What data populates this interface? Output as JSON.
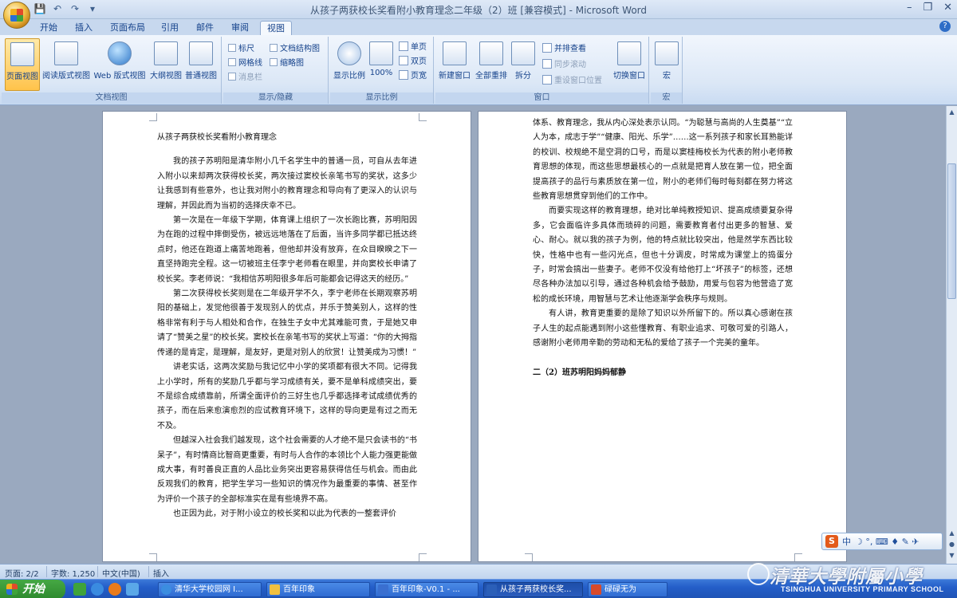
{
  "window": {
    "title": "从孩子两获校长奖看附小教育理念二年级（2）班 [兼容模式] - Microsoft Word",
    "controls": {
      "minimize": "–",
      "maximize": "❐",
      "close": "✕"
    }
  },
  "qat": {
    "save": "💾",
    "undo": "↶",
    "redo": "↷",
    "more": "▾"
  },
  "tabs": [
    {
      "label": "开始"
    },
    {
      "label": "插入"
    },
    {
      "label": "页面布局"
    },
    {
      "label": "引用"
    },
    {
      "label": "邮件"
    },
    {
      "label": "审阅"
    },
    {
      "label": "视图"
    }
  ],
  "ribbon": {
    "doc_views": {
      "label": "文档视图",
      "buttons": [
        {
          "label": "页面视图",
          "active": true
        },
        {
          "label": "阅读版式视图"
        },
        {
          "label": "Web 版式视图"
        },
        {
          "label": "大纲视图"
        },
        {
          "label": "普通视图"
        }
      ]
    },
    "show_hide": {
      "label": "显示/隐藏",
      "items": [
        {
          "label": "标尺"
        },
        {
          "label": "文档结构图"
        },
        {
          "label": "网格线"
        },
        {
          "label": "缩略图"
        },
        {
          "label": "消息栏"
        }
      ]
    },
    "zoom": {
      "label": "显示比例",
      "zoom_btn": "显示比例",
      "hundred": "100%",
      "one_page": "单页",
      "two_pages": "双页",
      "page_width": "页宽"
    },
    "window": {
      "label": "窗口",
      "new_window": "新建窗口",
      "arrange_all": "全部重排",
      "split": "拆分",
      "side_by_side": "并排查看",
      "sync_scroll": "同步滚动",
      "reset_pos": "重设窗口位置",
      "switch_windows": "切换窗口"
    },
    "macros": {
      "label": "宏",
      "btn": "宏"
    }
  },
  "doc": {
    "title": "从孩子两获校长奖看附小教育理念",
    "left_paragraphs": [
      "我的孩子苏明阳是清华附小几千名学生中的普通一员，可自从去年进入附小以来却两次获得校长奖，两次接过窦校长亲笔书写的奖状，这多少让我感到有些意外，也让我对附小的教育理念和导向有了更深入的认识与理解，并因此而为当初的选择庆幸不已。",
      "第一次是在一年级下学期，体育课上组织了一次长跑比赛，苏明阳因为在跑的过程中摔倒受伤，被远远地落在了后面，当许多同学都已抵达终点时，他还在跑道上痛苦地跑着，但他却并没有放弃，在众目睽睽之下一直坚持跑完全程。这一切被班主任李宁老师看在眼里，并向窦校长申请了校长奖。李老师说：“我相信苏明阳很多年后可能都会记得这天的经历。”",
      "第二次获得校长奖则是在二年级开学不久，李宁老师在长期观察苏明阳的基础上，发觉他很善于发现别人的优点，并乐于赞美别人，这样的性格非常有利于与人相处和合作，在独生子女中尤其难能可贵，于是她又申请了“赞美之星”的校长奖。窦校长在亲笔书写的奖状上写道：“你的大拇指传递的是肯定，是理解，是友好，更是对别人的欣赏！让赞美成为习惯！”",
      "讲老实话，这两次奖励与我记忆中小学的奖项都有很大不同。记得我上小学时，所有的奖励几乎都与学习成绩有关，要不是单科成绩突出，要不是综合成绩靠前，所谓全面评价的三好生也几乎都选择考试成绩优秀的孩子，而在后来愈演愈烈的应试教育环境下，这样的导向更是有过之而无不及。",
      "但越深入社会我们越发现，这个社会需要的人才绝不是只会读书的“书呆子”，有时情商比智商更重要，有时与人合作的本领比个人能力强更能做成大事，有时善良正直的人品比业务突出更容易获得信任与机会。而由此反观我们的教育，把学生学习一些知识的情况作为最重要的事情、甚至作为评价一个孩子的全部标准实在是有些境界不高。",
      "也正因为此，对于附小设立的校长奖和以此为代表的一整套评价"
    ],
    "right_paragraphs": [
      "体系、教育理念，我从内心深处表示认同。“为聪慧与高尚的人生奠基”“立人为本，成志于学”“健康、阳光、乐学”……这一系列孩子和家长耳熟能详的校训、校规绝不是空洞的口号，而是以窦桂梅校长为代表的附小老师教育思想的体现，而这些思想最核心的一点就是把育人放在第一位，把全面提高孩子的品行与素质放在第一位，附小的老师们每时每刻都在努力将这些教育思想贯穿到他们的工作中。",
      "而要实现这样的教育理想，绝对比单纯教授知识、提高成绩要复杂得多，它会面临许多具体而琐碎的问题，需要教育者付出更多的智慧、爱心、耐心。就以我的孩子为例，他的特点就比较突出，他是然学东西比较快，性格中也有一些闪光点，但也十分调皮，时常成为课堂上的捣蛋分子，时常会搞出一些妻子。老师不仅没有给他打上“坏孩子”的标签，还想尽各种办法加以引导，通过各种机会给予鼓励，用爱与包容为他营造了宽松的成长环境，用智慧与艺术让他逐渐学会秩序与规则。",
      "有人讲，教育更重要的是除了知识以外所留下的。所以真心感谢在孩子人生的起点能遇到附小这些懂教育、有职业追求、可敬可爱的引路人，感谢附小老师用辛勤的劳动和无私的爱给了孩子一个完美的童年。"
    ],
    "signature": "二（2）班苏明阳妈妈郁静"
  },
  "ime": {
    "logo": "S",
    "mode": "中",
    "icons": "☽ °, ⌨ ♦ ✎ ✈"
  },
  "statusbar": {
    "page": "页面: 2/2",
    "words": "字数: 1,250",
    "lang": "中文(中国)",
    "insert": "插入"
  },
  "taskbar": {
    "start": "开始",
    "tasks": [
      {
        "label": "清华大学校园网 I...",
        "color": "#3b8de0"
      },
      {
        "label": "百年印象",
        "color": "#f0c040"
      },
      {
        "label": "百年印象-V0.1 - ...",
        "color": "#3a6fd0"
      },
      {
        "label": "从孩子两获校长奖...",
        "color": "#2b5fb8",
        "active": true
      },
      {
        "label": "碌碌无为",
        "color": "#d84a2a"
      }
    ]
  },
  "watermark": {
    "text": "清華大學附屬小學",
    "sub": "TSINGHUA UNIVERSITY PRIMARY SCHOOL"
  }
}
